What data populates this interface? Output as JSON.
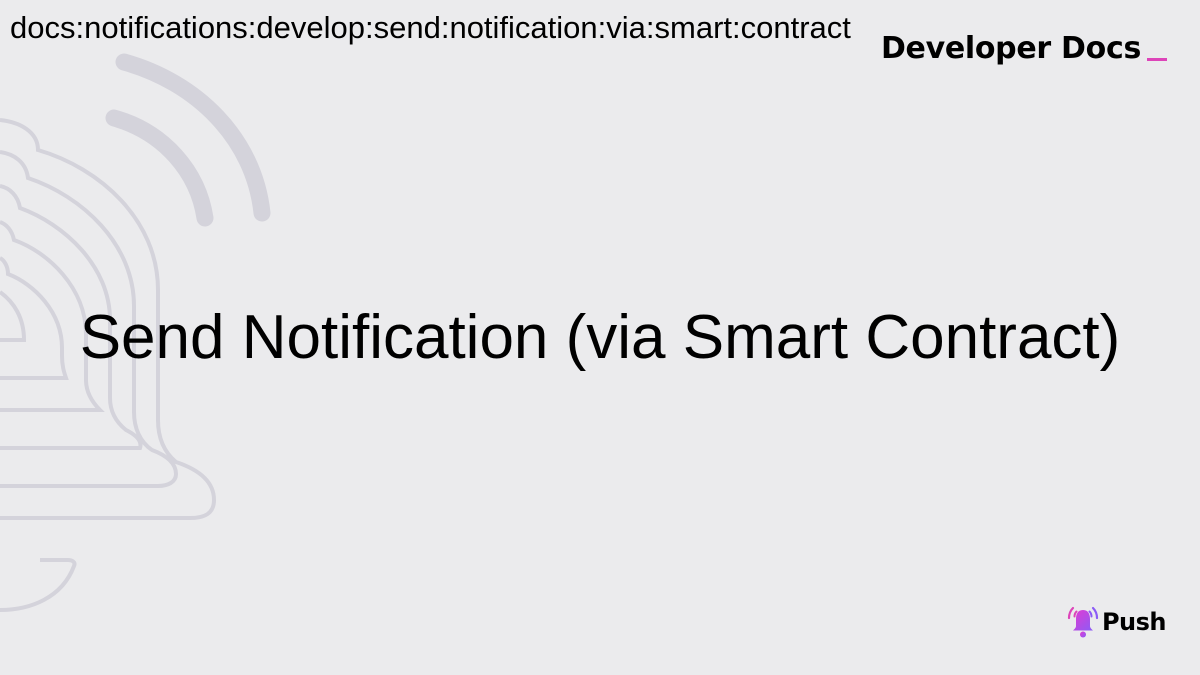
{
  "page": {
    "slug": "docs:notifications:develop:send:notification:via:smart:contract",
    "brand_label": "Developer Docs",
    "title": "Send Notification (via Smart Contract)"
  },
  "logo": {
    "wordmark": "Push",
    "icon": "bell-icon"
  },
  "background": {
    "decoration": "bell-outline-icon"
  },
  "colors": {
    "background": "#ebebed",
    "text": "#000000",
    "accent": "#dd44b9",
    "accent_secondary": "#8b5cf6",
    "decoration": "#d4d3db"
  }
}
